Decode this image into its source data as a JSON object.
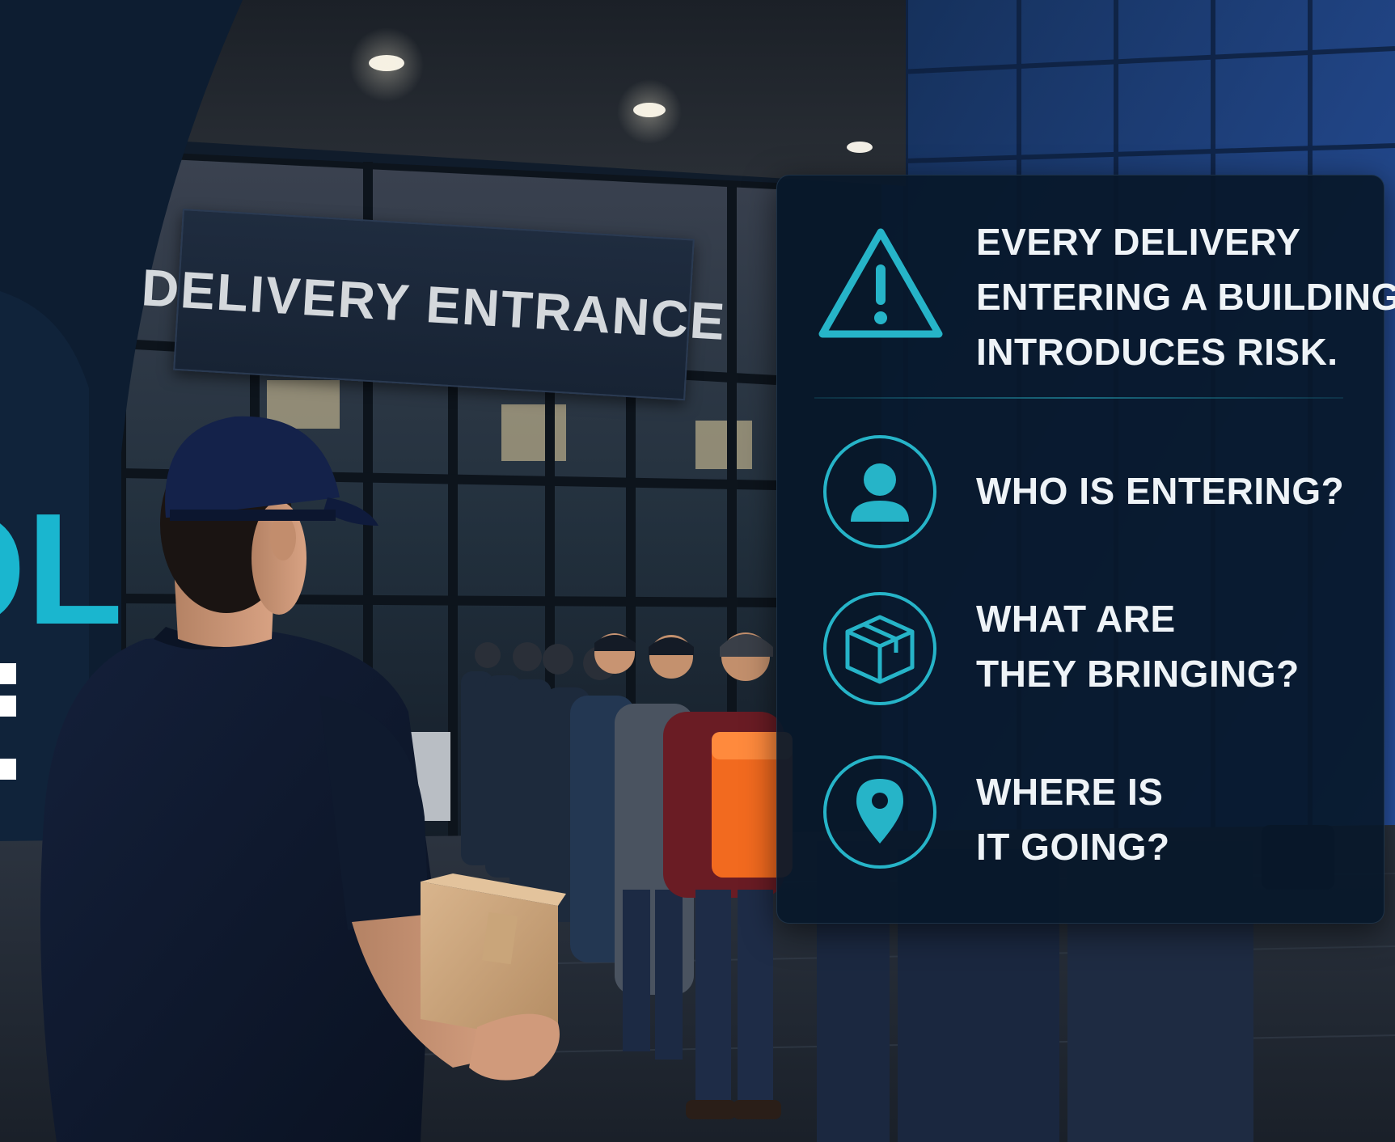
{
  "sign": {
    "text": "DELIVERY ENTRANCE"
  },
  "side_text": {
    "cyan_fragment": "OL"
  },
  "panel": {
    "headline": {
      "icon": "warning-triangle-icon",
      "lines": [
        "EVERY DELIVERY",
        "ENTERING A BUILDING",
        "INTRODUCES RISK."
      ]
    },
    "questions": [
      {
        "icon": "person-icon",
        "lines": [
          "WHO IS ENTERING?"
        ]
      },
      {
        "icon": "package-box-icon",
        "lines": [
          "WHAT ARE",
          "THEY BRINGING?"
        ]
      },
      {
        "icon": "location-pin-icon",
        "lines": [
          "WHERE IS",
          "IT GOING?"
        ]
      }
    ]
  },
  "colors": {
    "accent": "#26b4c8",
    "panel_bg": "#08182a",
    "text": "#eef3f7",
    "backpack_orange": "#f26a1f"
  }
}
